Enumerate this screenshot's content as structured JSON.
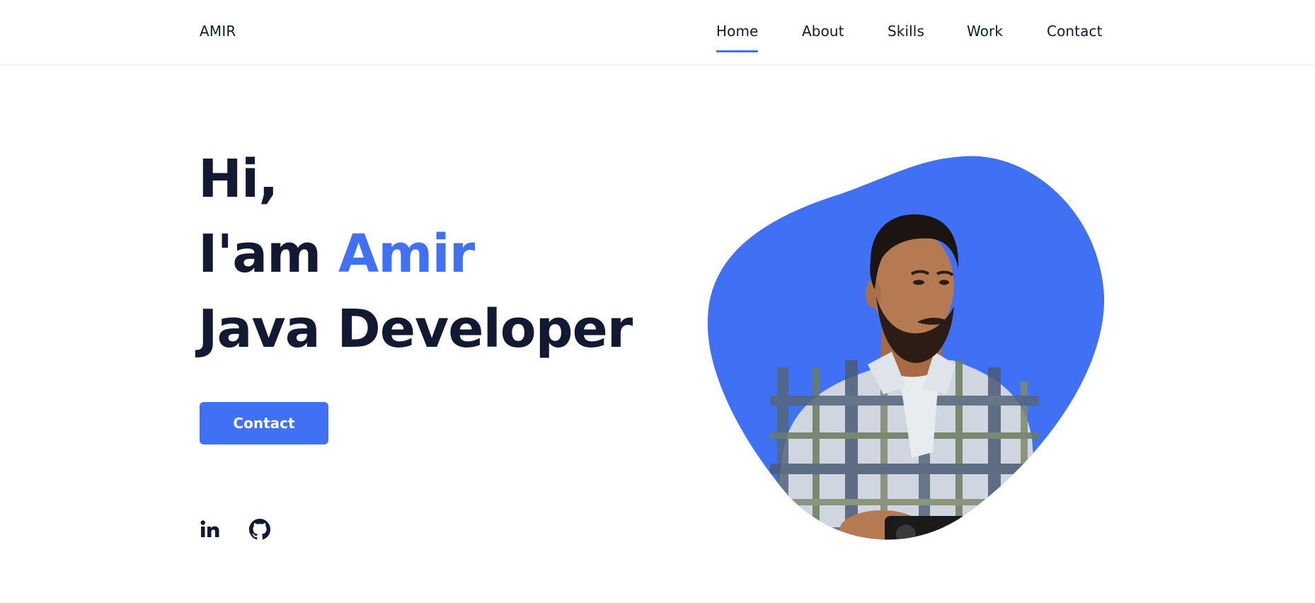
{
  "header": {
    "logo": "AMIR",
    "nav": [
      {
        "label": "Home",
        "active": true
      },
      {
        "label": "About",
        "active": false
      },
      {
        "label": "Skills",
        "active": false
      },
      {
        "label": "Work",
        "active": false
      },
      {
        "label": "Contact",
        "active": false
      }
    ]
  },
  "hero": {
    "greeting": "Hi,",
    "intro_prefix": "I'am ",
    "name": "Amir",
    "role": "Java Developer",
    "button_label": "Contact"
  },
  "social": [
    {
      "name": "linkedin",
      "icon": "linkedin-icon"
    },
    {
      "name": "github",
      "icon": "github-icon"
    }
  ],
  "colors": {
    "accent": "#4070f4",
    "text": "#121933",
    "background": "#ffffff"
  }
}
